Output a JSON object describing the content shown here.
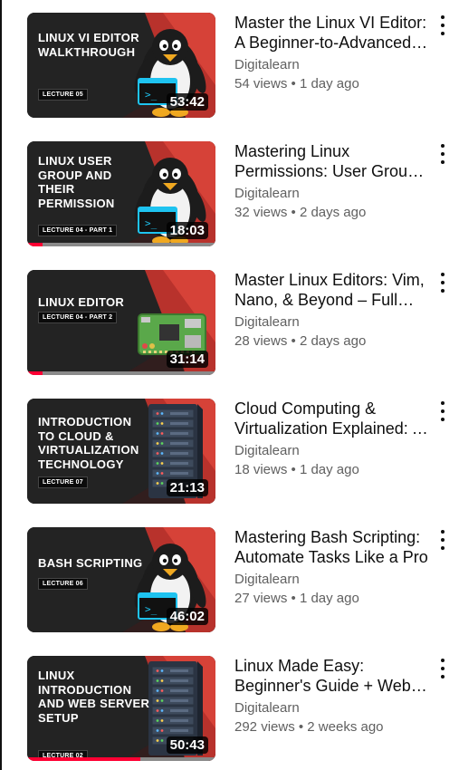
{
  "videos": [
    {
      "thumb_title": "LINUX VI EDITOR WALKTHROUGH",
      "lecture": "LECTURE 05",
      "art": "penguin-terminal-icon",
      "duration": "53:42",
      "progress": 0,
      "title": "Master the Linux VI Editor: A Beginner-to-Advanced Guide",
      "channel": "Digitalearn",
      "meta": "54 views • 1 day ago"
    },
    {
      "thumb_title": "LINUX USER GROUP AND THEIR PERMISSION",
      "lecture": "LECTURE 04 - PART 1",
      "art": "penguin-terminal-icon",
      "duration": "18:03",
      "progress": 0.08,
      "title": "Mastering Linux Permissions: User Groups Explained",
      "channel": "Digitalearn",
      "meta": "32 views • 2 days ago"
    },
    {
      "thumb_title": "LINUX EDITOR",
      "lecture": "LECTURE 04 - PART 2",
      "art": "circuit-board-icon",
      "duration": "31:14",
      "progress": 0.08,
      "title": "Master Linux Editors: Vim, Nano, & Beyond – Full Guide",
      "channel": "Digitalearn",
      "meta": "28 views • 2 days ago"
    },
    {
      "thumb_title": "INTRODUCTION TO CLOUD & VIRTUALIZATION TECHNOLOGY",
      "lecture": "LECTURE 07",
      "art": "server-rack-icon",
      "duration": "21:13",
      "progress": 0,
      "title": "Cloud Computing & Virtualization Explained: A Complete Guide",
      "channel": "Digitalearn",
      "meta": "18 views • 1 day ago"
    },
    {
      "thumb_title": "BASH SCRIPTING",
      "lecture": "LECTURE 06",
      "art": "penguin-terminal-icon",
      "duration": "46:02",
      "progress": 0,
      "title": "Mastering Bash Scripting: Automate Tasks Like a Pro",
      "channel": "Digitalearn",
      "meta": "27 views • 1 day ago"
    },
    {
      "thumb_title": "LINUX INTRODUCTION AND WEB SERVER SETUP",
      "lecture": "LECTURE 02",
      "art": "server-rack-icon",
      "duration": "50:43",
      "progress": 0.6,
      "title": "Linux Made Easy: Beginner's Guide + Web Server Setup",
      "channel": "Digitalearn",
      "meta": "292 views • 2 weeks ago"
    }
  ],
  "colors": {
    "thumb_bg": "#232323",
    "accent_red": "#c8362f",
    "progress": "#ff0033",
    "terminal": "#00b4e6"
  }
}
